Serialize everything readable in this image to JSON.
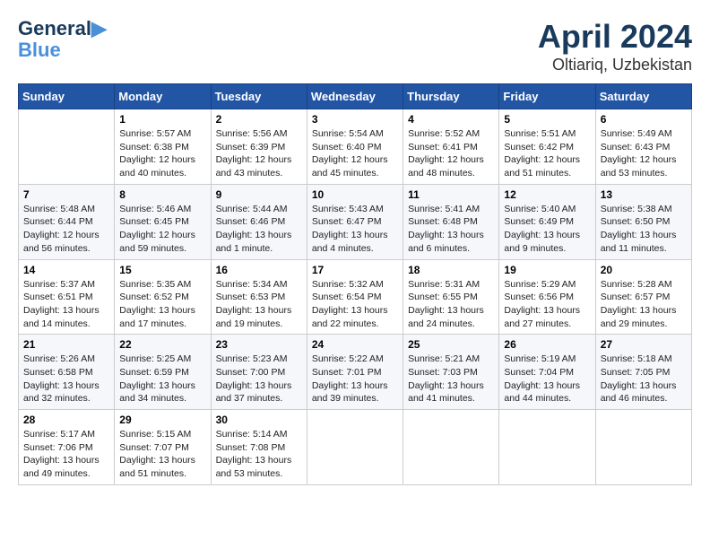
{
  "header": {
    "logo_line1": "General",
    "logo_line2": "Blue",
    "title": "April 2024",
    "subtitle": "Oltiariq, Uzbekistan"
  },
  "days_of_week": [
    "Sunday",
    "Monday",
    "Tuesday",
    "Wednesday",
    "Thursday",
    "Friday",
    "Saturday"
  ],
  "weeks": [
    [
      {
        "day": "",
        "sunrise": "",
        "sunset": "",
        "daylight": ""
      },
      {
        "day": "1",
        "sunrise": "Sunrise: 5:57 AM",
        "sunset": "Sunset: 6:38 PM",
        "daylight": "Daylight: 12 hours and 40 minutes."
      },
      {
        "day": "2",
        "sunrise": "Sunrise: 5:56 AM",
        "sunset": "Sunset: 6:39 PM",
        "daylight": "Daylight: 12 hours and 43 minutes."
      },
      {
        "day": "3",
        "sunrise": "Sunrise: 5:54 AM",
        "sunset": "Sunset: 6:40 PM",
        "daylight": "Daylight: 12 hours and 45 minutes."
      },
      {
        "day": "4",
        "sunrise": "Sunrise: 5:52 AM",
        "sunset": "Sunset: 6:41 PM",
        "daylight": "Daylight: 12 hours and 48 minutes."
      },
      {
        "day": "5",
        "sunrise": "Sunrise: 5:51 AM",
        "sunset": "Sunset: 6:42 PM",
        "daylight": "Daylight: 12 hours and 51 minutes."
      },
      {
        "day": "6",
        "sunrise": "Sunrise: 5:49 AM",
        "sunset": "Sunset: 6:43 PM",
        "daylight": "Daylight: 12 hours and 53 minutes."
      }
    ],
    [
      {
        "day": "7",
        "sunrise": "Sunrise: 5:48 AM",
        "sunset": "Sunset: 6:44 PM",
        "daylight": "Daylight: 12 hours and 56 minutes."
      },
      {
        "day": "8",
        "sunrise": "Sunrise: 5:46 AM",
        "sunset": "Sunset: 6:45 PM",
        "daylight": "Daylight: 12 hours and 59 minutes."
      },
      {
        "day": "9",
        "sunrise": "Sunrise: 5:44 AM",
        "sunset": "Sunset: 6:46 PM",
        "daylight": "Daylight: 13 hours and 1 minute."
      },
      {
        "day": "10",
        "sunrise": "Sunrise: 5:43 AM",
        "sunset": "Sunset: 6:47 PM",
        "daylight": "Daylight: 13 hours and 4 minutes."
      },
      {
        "day": "11",
        "sunrise": "Sunrise: 5:41 AM",
        "sunset": "Sunset: 6:48 PM",
        "daylight": "Daylight: 13 hours and 6 minutes."
      },
      {
        "day": "12",
        "sunrise": "Sunrise: 5:40 AM",
        "sunset": "Sunset: 6:49 PM",
        "daylight": "Daylight: 13 hours and 9 minutes."
      },
      {
        "day": "13",
        "sunrise": "Sunrise: 5:38 AM",
        "sunset": "Sunset: 6:50 PM",
        "daylight": "Daylight: 13 hours and 11 minutes."
      }
    ],
    [
      {
        "day": "14",
        "sunrise": "Sunrise: 5:37 AM",
        "sunset": "Sunset: 6:51 PM",
        "daylight": "Daylight: 13 hours and 14 minutes."
      },
      {
        "day": "15",
        "sunrise": "Sunrise: 5:35 AM",
        "sunset": "Sunset: 6:52 PM",
        "daylight": "Daylight: 13 hours and 17 minutes."
      },
      {
        "day": "16",
        "sunrise": "Sunrise: 5:34 AM",
        "sunset": "Sunset: 6:53 PM",
        "daylight": "Daylight: 13 hours and 19 minutes."
      },
      {
        "day": "17",
        "sunrise": "Sunrise: 5:32 AM",
        "sunset": "Sunset: 6:54 PM",
        "daylight": "Daylight: 13 hours and 22 minutes."
      },
      {
        "day": "18",
        "sunrise": "Sunrise: 5:31 AM",
        "sunset": "Sunset: 6:55 PM",
        "daylight": "Daylight: 13 hours and 24 minutes."
      },
      {
        "day": "19",
        "sunrise": "Sunrise: 5:29 AM",
        "sunset": "Sunset: 6:56 PM",
        "daylight": "Daylight: 13 hours and 27 minutes."
      },
      {
        "day": "20",
        "sunrise": "Sunrise: 5:28 AM",
        "sunset": "Sunset: 6:57 PM",
        "daylight": "Daylight: 13 hours and 29 minutes."
      }
    ],
    [
      {
        "day": "21",
        "sunrise": "Sunrise: 5:26 AM",
        "sunset": "Sunset: 6:58 PM",
        "daylight": "Daylight: 13 hours and 32 minutes."
      },
      {
        "day": "22",
        "sunrise": "Sunrise: 5:25 AM",
        "sunset": "Sunset: 6:59 PM",
        "daylight": "Daylight: 13 hours and 34 minutes."
      },
      {
        "day": "23",
        "sunrise": "Sunrise: 5:23 AM",
        "sunset": "Sunset: 7:00 PM",
        "daylight": "Daylight: 13 hours and 37 minutes."
      },
      {
        "day": "24",
        "sunrise": "Sunrise: 5:22 AM",
        "sunset": "Sunset: 7:01 PM",
        "daylight": "Daylight: 13 hours and 39 minutes."
      },
      {
        "day": "25",
        "sunrise": "Sunrise: 5:21 AM",
        "sunset": "Sunset: 7:03 PM",
        "daylight": "Daylight: 13 hours and 41 minutes."
      },
      {
        "day": "26",
        "sunrise": "Sunrise: 5:19 AM",
        "sunset": "Sunset: 7:04 PM",
        "daylight": "Daylight: 13 hours and 44 minutes."
      },
      {
        "day": "27",
        "sunrise": "Sunrise: 5:18 AM",
        "sunset": "Sunset: 7:05 PM",
        "daylight": "Daylight: 13 hours and 46 minutes."
      }
    ],
    [
      {
        "day": "28",
        "sunrise": "Sunrise: 5:17 AM",
        "sunset": "Sunset: 7:06 PM",
        "daylight": "Daylight: 13 hours and 49 minutes."
      },
      {
        "day": "29",
        "sunrise": "Sunrise: 5:15 AM",
        "sunset": "Sunset: 7:07 PM",
        "daylight": "Daylight: 13 hours and 51 minutes."
      },
      {
        "day": "30",
        "sunrise": "Sunrise: 5:14 AM",
        "sunset": "Sunset: 7:08 PM",
        "daylight": "Daylight: 13 hours and 53 minutes."
      },
      {
        "day": "",
        "sunrise": "",
        "sunset": "",
        "daylight": ""
      },
      {
        "day": "",
        "sunrise": "",
        "sunset": "",
        "daylight": ""
      },
      {
        "day": "",
        "sunrise": "",
        "sunset": "",
        "daylight": ""
      },
      {
        "day": "",
        "sunrise": "",
        "sunset": "",
        "daylight": ""
      }
    ]
  ]
}
